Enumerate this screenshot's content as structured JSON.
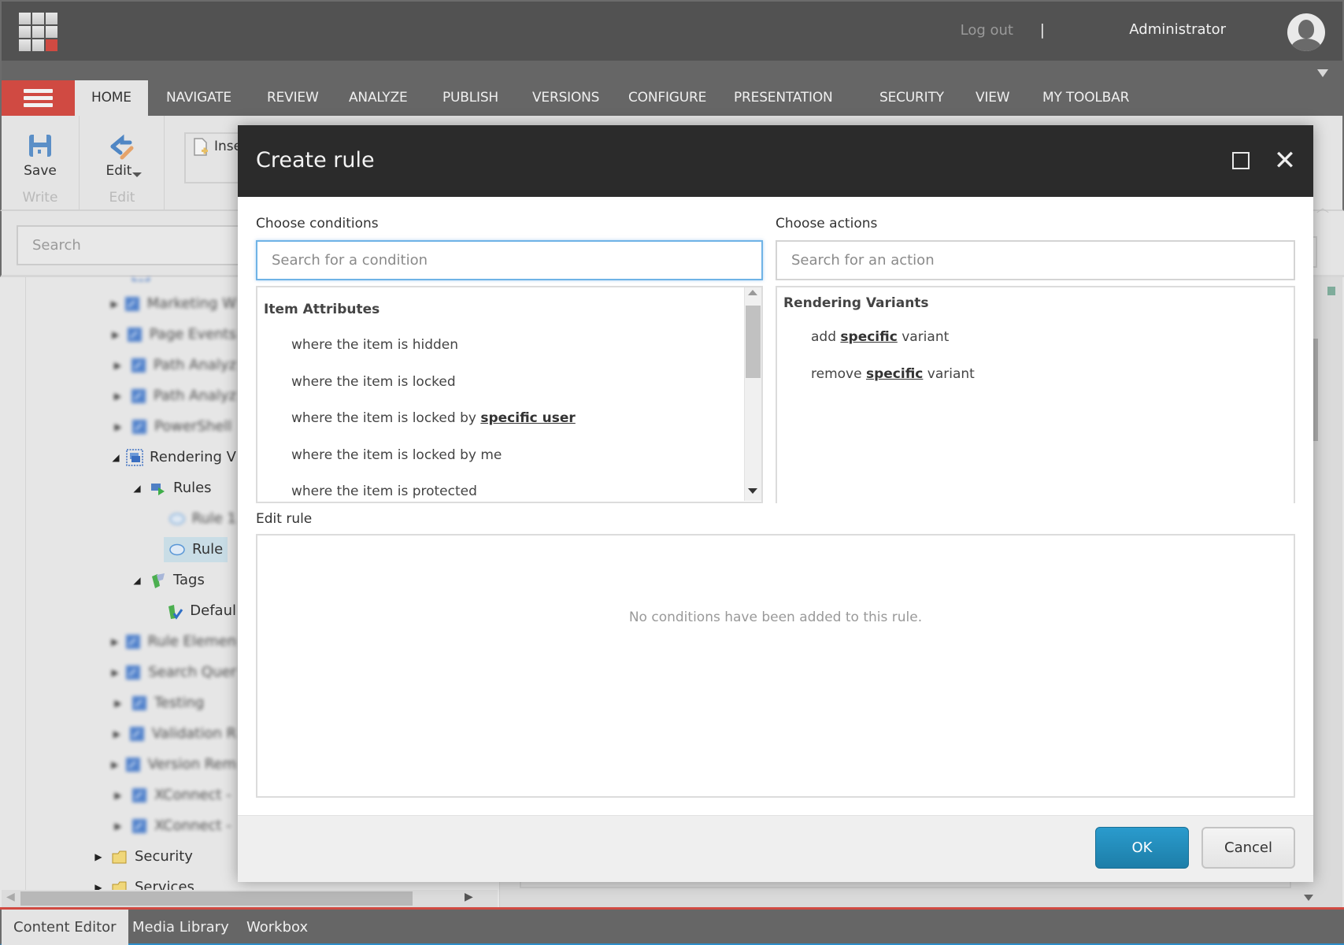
{
  "header": {
    "logout_label": "Log out",
    "separator": "|",
    "username": "Administrator"
  },
  "ribbon_tabs": [
    "HOME",
    "NAVIGATE",
    "REVIEW",
    "ANALYZE",
    "PUBLISH",
    "VERSIONS",
    "CONFIGURE",
    "PRESENTATION",
    "SECURITY",
    "VIEW",
    "MY TOOLBAR"
  ],
  "ribbon": {
    "save_label": "Save",
    "write_group": "Write",
    "edit_label": "Edit",
    "edit_group": "Edit",
    "insert_label": "Inse"
  },
  "tree_search_placeholder": "Search",
  "tree": {
    "items": [
      {
        "label": "Marketing W",
        "blurred": true
      },
      {
        "label": "Page Events",
        "blurred": true
      },
      {
        "label": "Path Analyz",
        "blurred": true
      },
      {
        "label": "Path Analyz",
        "blurred": true
      },
      {
        "label": "PowerShell",
        "blurred": true
      },
      {
        "label": "Rendering V"
      },
      {
        "label": "Rules"
      },
      {
        "label": "Rule 1",
        "blurred": true
      },
      {
        "label": "Rule",
        "selected": true
      },
      {
        "label": "Tags"
      },
      {
        "label": "Defaul"
      },
      {
        "label": "Rule Elemen",
        "blurred": true
      },
      {
        "label": "Search Quer",
        "blurred": true
      },
      {
        "label": "Testing",
        "blurred": true
      },
      {
        "label": "Validation R",
        "blurred": true
      },
      {
        "label": "Version Rem",
        "blurred": true
      },
      {
        "label": "XConnect - ",
        "blurred": true
      },
      {
        "label": "XConnect - ",
        "blurred": true
      },
      {
        "label": "Security"
      },
      {
        "label": "Services"
      }
    ]
  },
  "bottom_tabs": [
    "Content Editor",
    "Media Library",
    "Workbox"
  ],
  "dialog": {
    "title": "Create rule",
    "conditions": {
      "label": "Choose conditions",
      "placeholder": "Search for a condition",
      "group": "Item Attributes",
      "items": [
        {
          "pre": "where the item is hidden",
          "link": "",
          "post": ""
        },
        {
          "pre": "where the item is locked",
          "link": "",
          "post": ""
        },
        {
          "pre": "where the item is locked by ",
          "link": "specific user",
          "post": ""
        },
        {
          "pre": "where the item is locked by me",
          "link": "",
          "post": ""
        },
        {
          "pre": "where the item is protected",
          "link": "",
          "post": ""
        }
      ]
    },
    "actions": {
      "label": "Choose actions",
      "placeholder": "Search for an action",
      "group": "Rendering Variants",
      "items": [
        {
          "pre": "add ",
          "link": "specific",
          "post": " variant"
        },
        {
          "pre": "remove ",
          "link": "specific",
          "post": " variant"
        }
      ]
    },
    "edit_rule": {
      "label": "Edit rule",
      "empty_message": "No conditions have been added to this rule."
    },
    "ok_label": "OK",
    "cancel_label": "Cancel"
  },
  "colors": {
    "accent_red": "#d04a42",
    "ok_blue": "#2390bf",
    "focus_blue": "#6fb3e6",
    "dialog_header": "#2b2b2b"
  }
}
